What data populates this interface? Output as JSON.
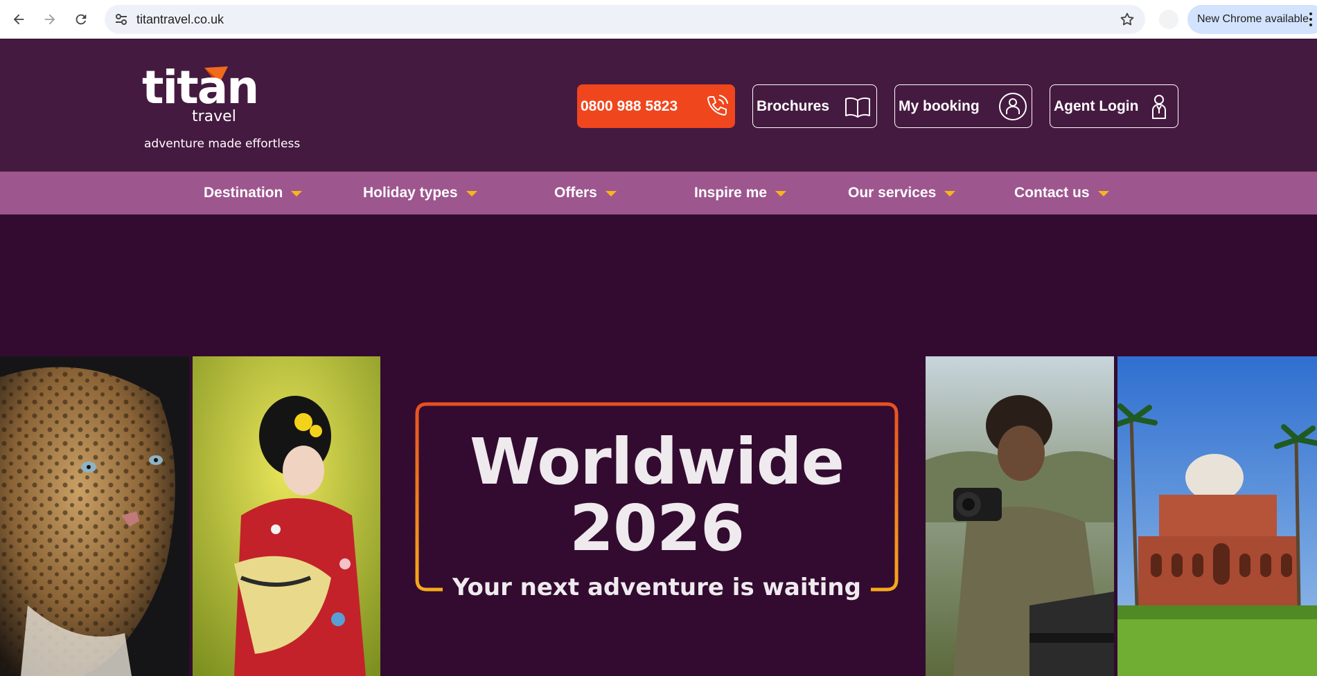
{
  "browser": {
    "url": "titantravel.co.uk",
    "update_label": "New Chrome available"
  },
  "header": {
    "logo_word": "titan",
    "logo_sub": "travel",
    "tagline": "adventure made effortless",
    "phone": "0800 988 5823",
    "brochures": "Brochures",
    "my_booking": "My booking",
    "agent_login": "Agent Login"
  },
  "nav": {
    "items": [
      "Destination",
      "Holiday types",
      "Offers",
      "Inspire me",
      "Our services",
      "Contact us"
    ]
  },
  "hero": {
    "title_line1": "Worldwide",
    "title_line2": "2026",
    "subtitle": "Your next adventure is waiting"
  },
  "colors": {
    "header_bg": "#451a40",
    "nav_bg": "#9e568e",
    "hero_bg": "#330b30",
    "phone_bg": "#f0461e",
    "caret": "#f7b61a"
  },
  "icons": {
    "back": "back-arrow-icon",
    "forward": "forward-arrow-icon",
    "reload": "reload-icon",
    "site_settings": "tune-icon",
    "bookmark": "star-icon",
    "phone": "phone-icon",
    "brochures": "book-icon",
    "my_booking": "user-icon",
    "agent_login": "agent-icon"
  }
}
